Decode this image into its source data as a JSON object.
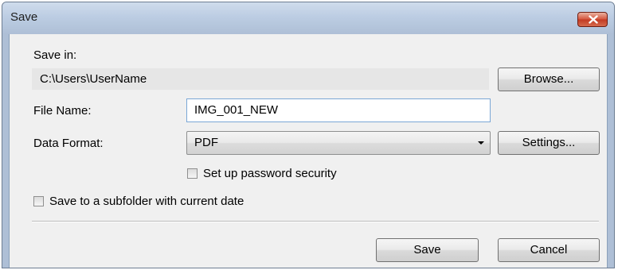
{
  "window": {
    "title": "Save"
  },
  "save_in": {
    "label": "Save in:",
    "path": "C:\\Users\\UserName",
    "browse_label": "Browse..."
  },
  "file_name": {
    "label": "File Name:",
    "value": "IMG_001_NEW"
  },
  "data_format": {
    "label": "Data Format:",
    "selected": "PDF",
    "settings_label": "Settings..."
  },
  "options": {
    "password_security": {
      "label": "Set up password security",
      "checked": false
    },
    "subfolder": {
      "label": "Save to a subfolder with current date",
      "checked": false
    }
  },
  "footer": {
    "save_label": "Save",
    "cancel_label": "Cancel"
  },
  "icons": {
    "close": "close-icon",
    "dropdown": "chevron-down-icon"
  },
  "colors": {
    "title_bar": "#bccde3",
    "close_button": "#c23a22",
    "dialog_background": "#f0f0f0"
  }
}
